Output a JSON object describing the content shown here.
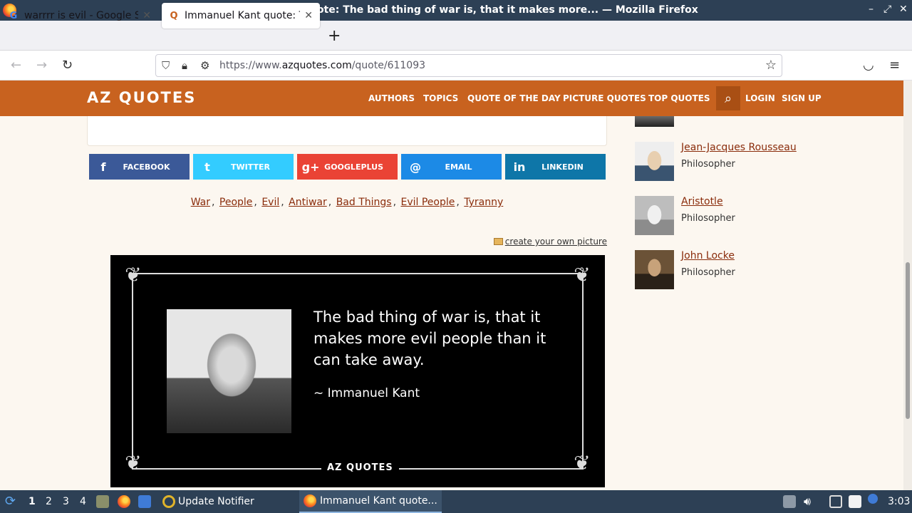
{
  "window": {
    "title": "Immanuel Kant quote: The bad thing of war is, that it makes more... — Mozilla Firefox"
  },
  "tabs": [
    {
      "label": "warrrr is evil - Google Search",
      "favicon": "G"
    },
    {
      "label": "Immanuel Kant quote: The bad thing of war is...",
      "favicon": "Q"
    }
  ],
  "urlbar": {
    "prefix": "https://www.",
    "domain": "azquotes.com",
    "path": "/quote/611093"
  },
  "site": {
    "logo": "AZ QUOTES",
    "menu": [
      "AUTHORS",
      "TOPICS",
      "QUOTE OF THE DAY",
      "PICTURE QUOTES",
      "TOP QUOTES"
    ],
    "login": "LOGIN",
    "signup": "SIGN UP"
  },
  "share": [
    {
      "label": "FACEBOOK",
      "color": "#3b5998",
      "icon": "f"
    },
    {
      "label": "TWITTER",
      "color": "#33ccff",
      "icon": "t"
    },
    {
      "label": "GOOGLEPLUS",
      "color": "#ea4335",
      "icon": "g+"
    },
    {
      "label": "EMAIL",
      "color": "#1c8ae6",
      "icon": "@"
    },
    {
      "label": "LINKEDIN",
      "color": "#0e76a8",
      "icon": "in"
    }
  ],
  "tags": [
    "War",
    "People",
    "Evil",
    "Antiwar",
    "Bad Things",
    "Evil People",
    "Tyranny"
  ],
  "create_picture": "create your own picture",
  "quote": {
    "text": "The bad thing of war is, that it makes more evil people than it can take away.",
    "author": "~ Immanuel Kant",
    "brand": "AZ QUOTES"
  },
  "sidebar": [
    {
      "name": "Jean-Jacques Rousseau",
      "role": "Philosopher"
    },
    {
      "name": "Aristotle",
      "role": "Philosopher"
    },
    {
      "name": "John Locke",
      "role": "Philosopher"
    }
  ],
  "taskbar": {
    "workspaces": [
      "1",
      "2",
      "3",
      "4"
    ],
    "tasks": [
      "Update Notifier",
      "Immanuel Kant quote..."
    ],
    "clock": "3:03"
  }
}
